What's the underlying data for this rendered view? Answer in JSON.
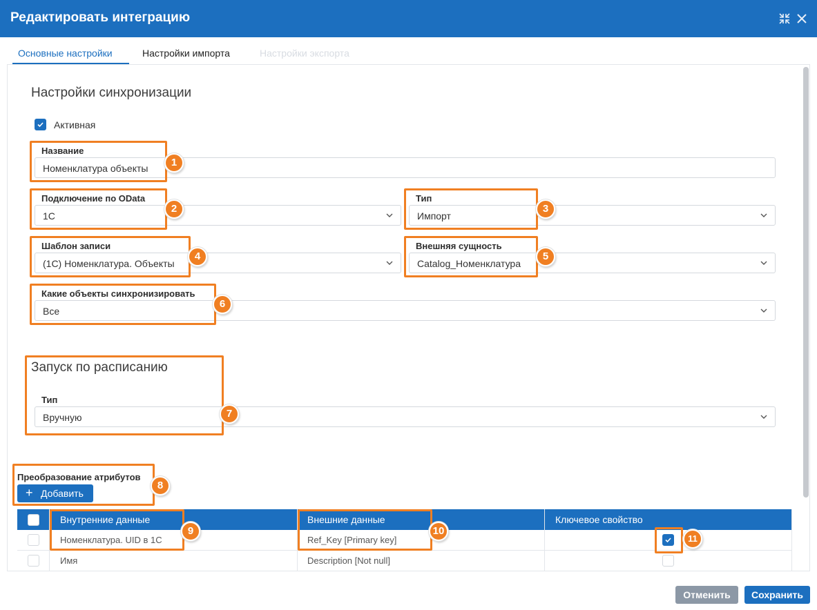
{
  "window": {
    "title": "Редактировать интеграцию",
    "collapse_icon": "collapse-icon",
    "close_icon": "close-icon"
  },
  "tabs": [
    {
      "label": "Основные настройки",
      "active": true
    },
    {
      "label": "Настройки импорта",
      "active": false
    },
    {
      "label": "Настройки экспорта",
      "active": false,
      "disabled": true
    }
  ],
  "sync": {
    "section_title": "Настройки синхронизации",
    "active_label": "Активная",
    "active_checked": true,
    "name": {
      "label": "Название",
      "value": "Номенклатура объекты"
    },
    "connection": {
      "label": "Подключение по OData",
      "value": "1С"
    },
    "type": {
      "label": "Тип",
      "value": "Импорт"
    },
    "template": {
      "label": "Шаблон записи",
      "value": "(1С) Номенклатура. Объекты"
    },
    "external_entity": {
      "label": "Внешняя сущность",
      "value": "Catalog_Номенклатура"
    },
    "which_objects": {
      "label": "Какие объекты синхронизировать",
      "value": "Все"
    }
  },
  "schedule": {
    "section_title": "Запуск по расписанию",
    "type": {
      "label": "Тип",
      "value": "Вручную"
    }
  },
  "attributes": {
    "label": "Преобразование атрибутов",
    "add_button": "Добавить",
    "columns": [
      "Внутренние данные",
      "Внешние данные",
      "Ключевое свойство"
    ],
    "rows": [
      {
        "internal": "Номенклатура. UID в 1С",
        "external": "Ref_Key [Primary key]",
        "key": true
      },
      {
        "internal": "Имя",
        "external": "Description [Not null]",
        "key": false
      }
    ]
  },
  "annotations": [
    "1",
    "2",
    "3",
    "4",
    "5",
    "6",
    "7",
    "8",
    "9",
    "10",
    "11"
  ],
  "footer": {
    "cancel": "Отменить",
    "save": "Сохранить"
  },
  "colors": {
    "primary": "#1c6fbf",
    "annotation": "#f07f22",
    "cancel": "#8c98a6"
  }
}
